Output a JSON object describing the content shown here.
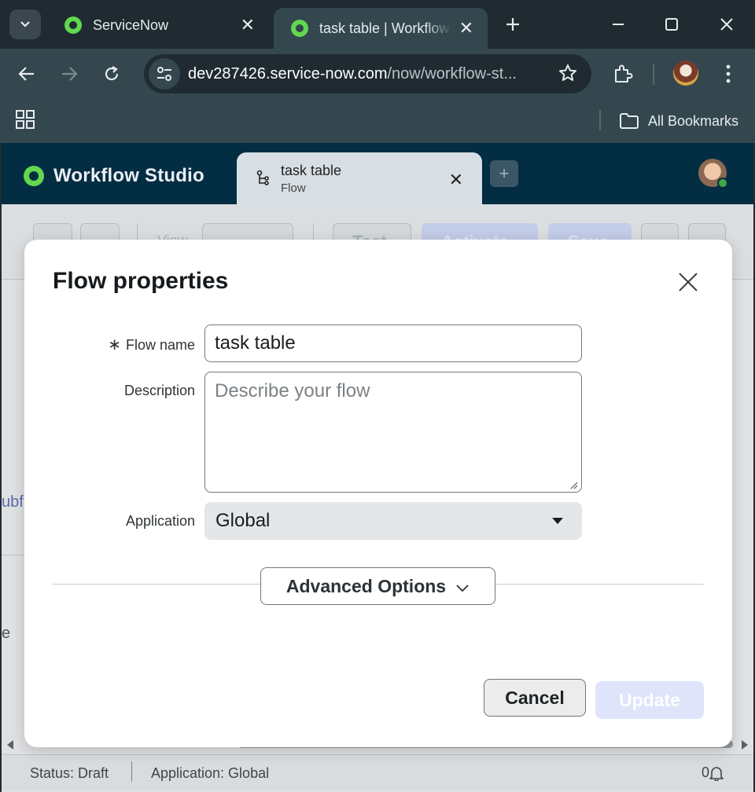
{
  "browser": {
    "tabs": [
      {
        "title": "ServiceNow"
      },
      {
        "title": "task table | Workflow Studio"
      }
    ],
    "url_host": "dev287426.service-now.com",
    "url_path": "/now/workflow-st...",
    "bookmarks_label": "All Bookmarks"
  },
  "app": {
    "name": "Workflow Studio",
    "tab": {
      "title": "task table",
      "subtitle": "Flow"
    },
    "toolbar": {
      "view_label": "View",
      "test_label": "Test",
      "activate_label": "Activate",
      "save_label": "Save"
    }
  },
  "background": {
    "link_fragment": "ubf",
    "text_fragment": "e"
  },
  "modal": {
    "title": "Flow properties",
    "flow_name_label": "Flow name",
    "required_mark": "∗",
    "flow_name_value": "task table",
    "description_label": "Description",
    "description_placeholder": "Describe your flow",
    "application_label": "Application",
    "application_value": "Global",
    "advanced_options_label": "Advanced Options",
    "cancel_label": "Cancel",
    "update_label": "Update"
  },
  "status_bar": {
    "status": "Status: Draft",
    "application": "Application: Global",
    "notifications_count": "0"
  },
  "colors": {
    "app_header": "#032d42",
    "brand_green": "#62d84e",
    "update_disabled": "#dfe4fb"
  }
}
